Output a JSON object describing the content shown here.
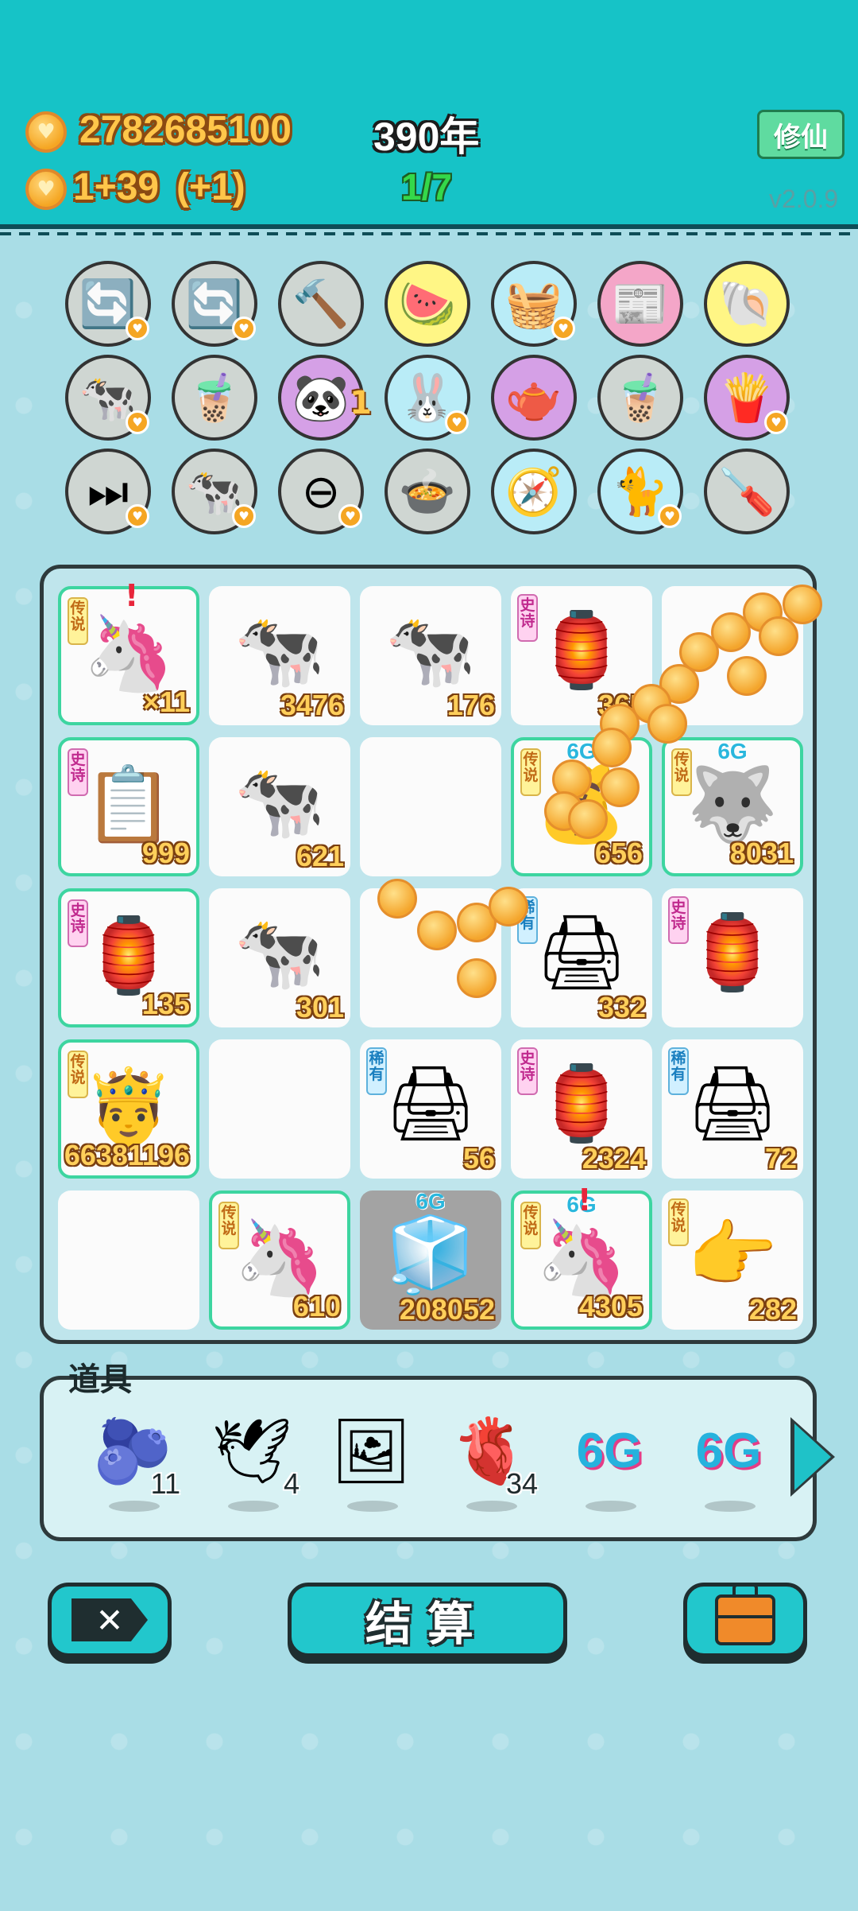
{
  "header": {
    "gold": "2782685100",
    "income": "1+39",
    "income_bonus": "(+1)",
    "year": "390年",
    "page": "1/7",
    "mode_button": "修仙",
    "version": "v2.0.9"
  },
  "skills": [
    {
      "name": "refresh-icon",
      "glyph": "🔄"
    },
    {
      "name": "refresh-icon",
      "glyph": "🔄"
    },
    {
      "name": "hammer-icon",
      "glyph": "🔨"
    },
    {
      "name": "fruit-platter-icon",
      "glyph": "🍉"
    },
    {
      "name": "fruit-basket-icon",
      "glyph": "🧺"
    },
    {
      "name": "magazine-icon",
      "glyph": "📰"
    },
    {
      "name": "shell-icon",
      "glyph": "🐚"
    },
    {
      "name": "cow-pair-icon",
      "glyph": "🐄"
    },
    {
      "name": "bubble-tea-icon",
      "glyph": "🧋"
    },
    {
      "name": "panda-icon",
      "glyph": "🐼"
    },
    {
      "name": "rabbit-icon",
      "glyph": "🐰"
    },
    {
      "name": "gravy-boat-icon",
      "glyph": "🫖"
    },
    {
      "name": "bubble-tea-icon",
      "glyph": "🧋"
    },
    {
      "name": "fries-icon",
      "glyph": "🍟"
    },
    {
      "name": "skip-icon",
      "glyph": "⏭"
    },
    {
      "name": "cow-pair-icon",
      "glyph": "🐄"
    },
    {
      "name": "minus-icon",
      "glyph": "⊖"
    },
    {
      "name": "pot-duck-icon",
      "glyph": "🍲"
    },
    {
      "name": "compass-icon",
      "glyph": "🧭"
    },
    {
      "name": "cat-icon",
      "glyph": "🐈"
    },
    {
      "name": "screwdriver-icon",
      "glyph": "🪛"
    }
  ],
  "skill_badge_panda": "1",
  "board": [
    [
      {
        "item": "unicorn-icon",
        "glyph": "🦄",
        "count": "×11",
        "tag": "传说",
        "tag_type": "chuanshuo",
        "legend": true,
        "excl": "!"
      },
      {
        "item": "cow-icon",
        "glyph": "🐄",
        "count": "3476"
      },
      {
        "item": "cow-icon",
        "glyph": "🐄",
        "count": "176"
      },
      {
        "item": "rabbit-house-icon",
        "glyph": "🏮",
        "count": "365",
        "tag": "史诗",
        "tag_type": "shishi"
      },
      {
        "item": "empty",
        "glyph": "",
        "count": ""
      }
    ],
    [
      {
        "item": "copy-paste-icon",
        "glyph": "📋",
        "count": "999",
        "tag": "史诗",
        "tag_type": "shishi",
        "legend": true
      },
      {
        "item": "cow-icon",
        "glyph": "🐄",
        "count": "621"
      },
      {
        "item": "empty",
        "glyph": "",
        "count": ""
      },
      {
        "item": "gold-pile-icon",
        "glyph": "💰",
        "count": "656",
        "tag": "传说",
        "tag_type": "chuanshuo",
        "legend": true,
        "sixg": "6G"
      },
      {
        "item": "husky-king-icon",
        "glyph": "🐺",
        "count": "8031",
        "tag": "传说",
        "tag_type": "chuanshuo",
        "legend": true,
        "sixg": "6G"
      }
    ],
    [
      {
        "item": "rabbit-house-icon",
        "glyph": "🏮",
        "count": "135",
        "tag": "史诗",
        "tag_type": "shishi",
        "legend": true
      },
      {
        "item": "cow-icon",
        "glyph": "🐄",
        "count": "301"
      },
      {
        "item": "empty",
        "glyph": "",
        "count": ""
      },
      {
        "item": "printer-icon",
        "glyph": "🖨",
        "count": "332",
        "tag": "稀有",
        "tag_type": "xiyou"
      },
      {
        "item": "rabbit-house-icon",
        "glyph": "🏮",
        "count": "",
        "tag": "史诗",
        "tag_type": "shishi"
      }
    ],
    [
      {
        "item": "king-face-icon",
        "glyph": "🤴",
        "count": "66381196",
        "tag": "传说",
        "tag_type": "chuanshuo",
        "legend": true
      },
      {
        "item": "empty",
        "glyph": "",
        "count": ""
      },
      {
        "item": "printer-icon",
        "glyph": "🖨",
        "count": "56",
        "tag": "稀有",
        "tag_type": "xiyou"
      },
      {
        "item": "rabbit-house-icon",
        "glyph": "🏮",
        "count": "2324",
        "tag": "史诗",
        "tag_type": "shishi"
      },
      {
        "item": "printer-icon",
        "glyph": "🖨",
        "count": "72",
        "tag": "稀有",
        "tag_type": "xiyou"
      }
    ],
    [
      {
        "item": "empty",
        "glyph": "",
        "count": ""
      },
      {
        "item": "unicorn-icon",
        "glyph": "🦄",
        "count": "610",
        "tag": "传说",
        "tag_type": "chuanshuo",
        "legend": true
      },
      {
        "item": "fridge-icon",
        "glyph": "🧊",
        "count": "208052",
        "sixg": "6G",
        "grey": true
      },
      {
        "item": "unicorn-icon",
        "glyph": "🦄",
        "count": "4305",
        "tag": "传说",
        "tag_type": "chuanshuo",
        "legend": true,
        "sixg": "6G",
        "excl": "!"
      },
      {
        "item": "pointing-hand-icon",
        "glyph": "👉",
        "count": "282",
        "tag": "传说",
        "tag_type": "chuanshuo"
      }
    ]
  ],
  "props": {
    "title": "道具",
    "items": [
      {
        "name": "blueberry-icon",
        "glyph": "🫐",
        "count": "11"
      },
      {
        "name": "pigeon-icon",
        "glyph": "🕊",
        "count": "4"
      },
      {
        "name": "frame-icon",
        "glyph": "🖼",
        "count": ""
      },
      {
        "name": "liver-icon",
        "glyph": "🫀",
        "count": "34"
      },
      {
        "name": "sixg-icon",
        "text": "6G",
        "count": ""
      },
      {
        "name": "sixg-icon",
        "text": "6G",
        "count": ""
      }
    ]
  },
  "buttons": {
    "close": "✕",
    "settle": "结算"
  },
  "colors": {
    "accent": "#16c3c7",
    "gold": "#ffc64a",
    "legend_border": "#3dd5a0"
  }
}
